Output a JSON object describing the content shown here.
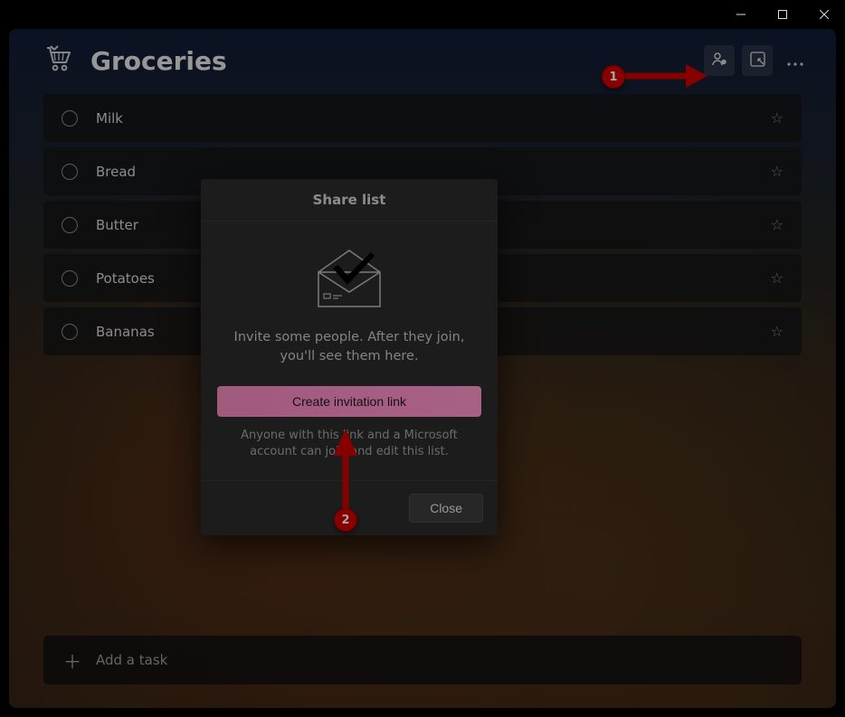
{
  "window_controls": {
    "min": "minimize",
    "max": "maximize",
    "close": "close"
  },
  "header": {
    "title": "Groceries",
    "icon_name": "cart-icon",
    "actions": {
      "share": "share-icon",
      "focus": "focus-view-icon",
      "more": "more-options-icon"
    }
  },
  "tasks": [
    {
      "label": "Milk"
    },
    {
      "label": "Bread"
    },
    {
      "label": "Butter"
    },
    {
      "label": "Potatoes"
    },
    {
      "label": "Bananas"
    }
  ],
  "add_task": {
    "placeholder": "Add a task"
  },
  "dialog": {
    "title": "Share list",
    "invite_text": "Invite some people. After they join, you'll see them here.",
    "create_link_label": "Create invitation link",
    "sub_text": "Anyone with this link and a Microsoft account can join and edit this list.",
    "close_label": "Close"
  },
  "annotations": {
    "badge1": "1",
    "badge2": "2"
  }
}
